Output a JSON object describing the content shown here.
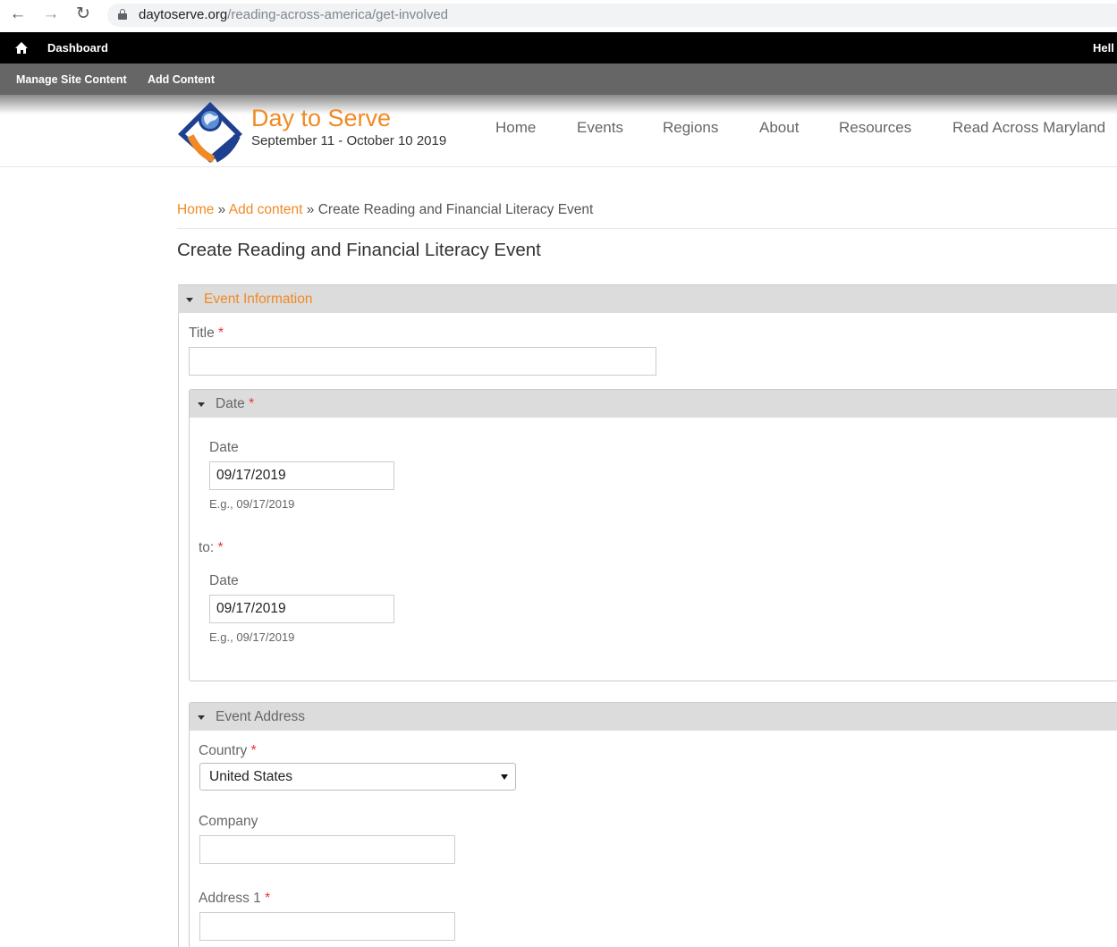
{
  "browser": {
    "url_domain": "daytoserve.org",
    "url_path": "/reading-across-america/get-involved"
  },
  "admin_bar": {
    "dashboard_label": "Dashboard",
    "greeting": "Hell"
  },
  "toolbar": {
    "manage_site_content": "Manage Site Content",
    "add_content": "Add Content"
  },
  "site": {
    "name": "Day to Serve",
    "dates": "September 11 - October 10 2019",
    "logo_text": "DAY TO SERVE"
  },
  "nav": {
    "items": [
      "Home",
      "Events",
      "Regions",
      "About",
      "Resources",
      "Read Across Maryland"
    ]
  },
  "breadcrumb": {
    "home": "Home",
    "sep": "»",
    "add_content": "Add content",
    "current": "Create Reading and Financial Literacy Event"
  },
  "page_title": "Create Reading and Financial Literacy Event",
  "form": {
    "event_information": {
      "legend": "Event Information",
      "title_label": "Title",
      "title_value": ""
    },
    "date_group": {
      "legend": "Date",
      "start_label": "Date",
      "start_value": "09/17/2019",
      "start_hint": "E.g., 09/17/2019",
      "to_label": "to:",
      "end_label": "Date",
      "end_value": "09/17/2019",
      "end_hint": "E.g., 09/17/2019"
    },
    "event_address": {
      "legend": "Event Address",
      "country_label": "Country",
      "country_value": "United States",
      "company_label": "Company",
      "company_value": "",
      "address1_label": "Address 1",
      "address1_value": ""
    },
    "required_mark": "*"
  },
  "colors": {
    "accent_orange": "#f08a24",
    "admin_bar": "#000000",
    "toolbar": "#666666",
    "legend_bg": "#dcdcdc",
    "required": "#ee3333",
    "logo_blue": "#1f3f8f"
  },
  "icons": {
    "back": "arrow-left-icon",
    "forward": "arrow-right-icon",
    "reload": "reload-icon",
    "lock": "lock-icon",
    "home": "home-icon",
    "collapse": "triangle-down-icon",
    "dropdown": "caret-down-icon"
  }
}
